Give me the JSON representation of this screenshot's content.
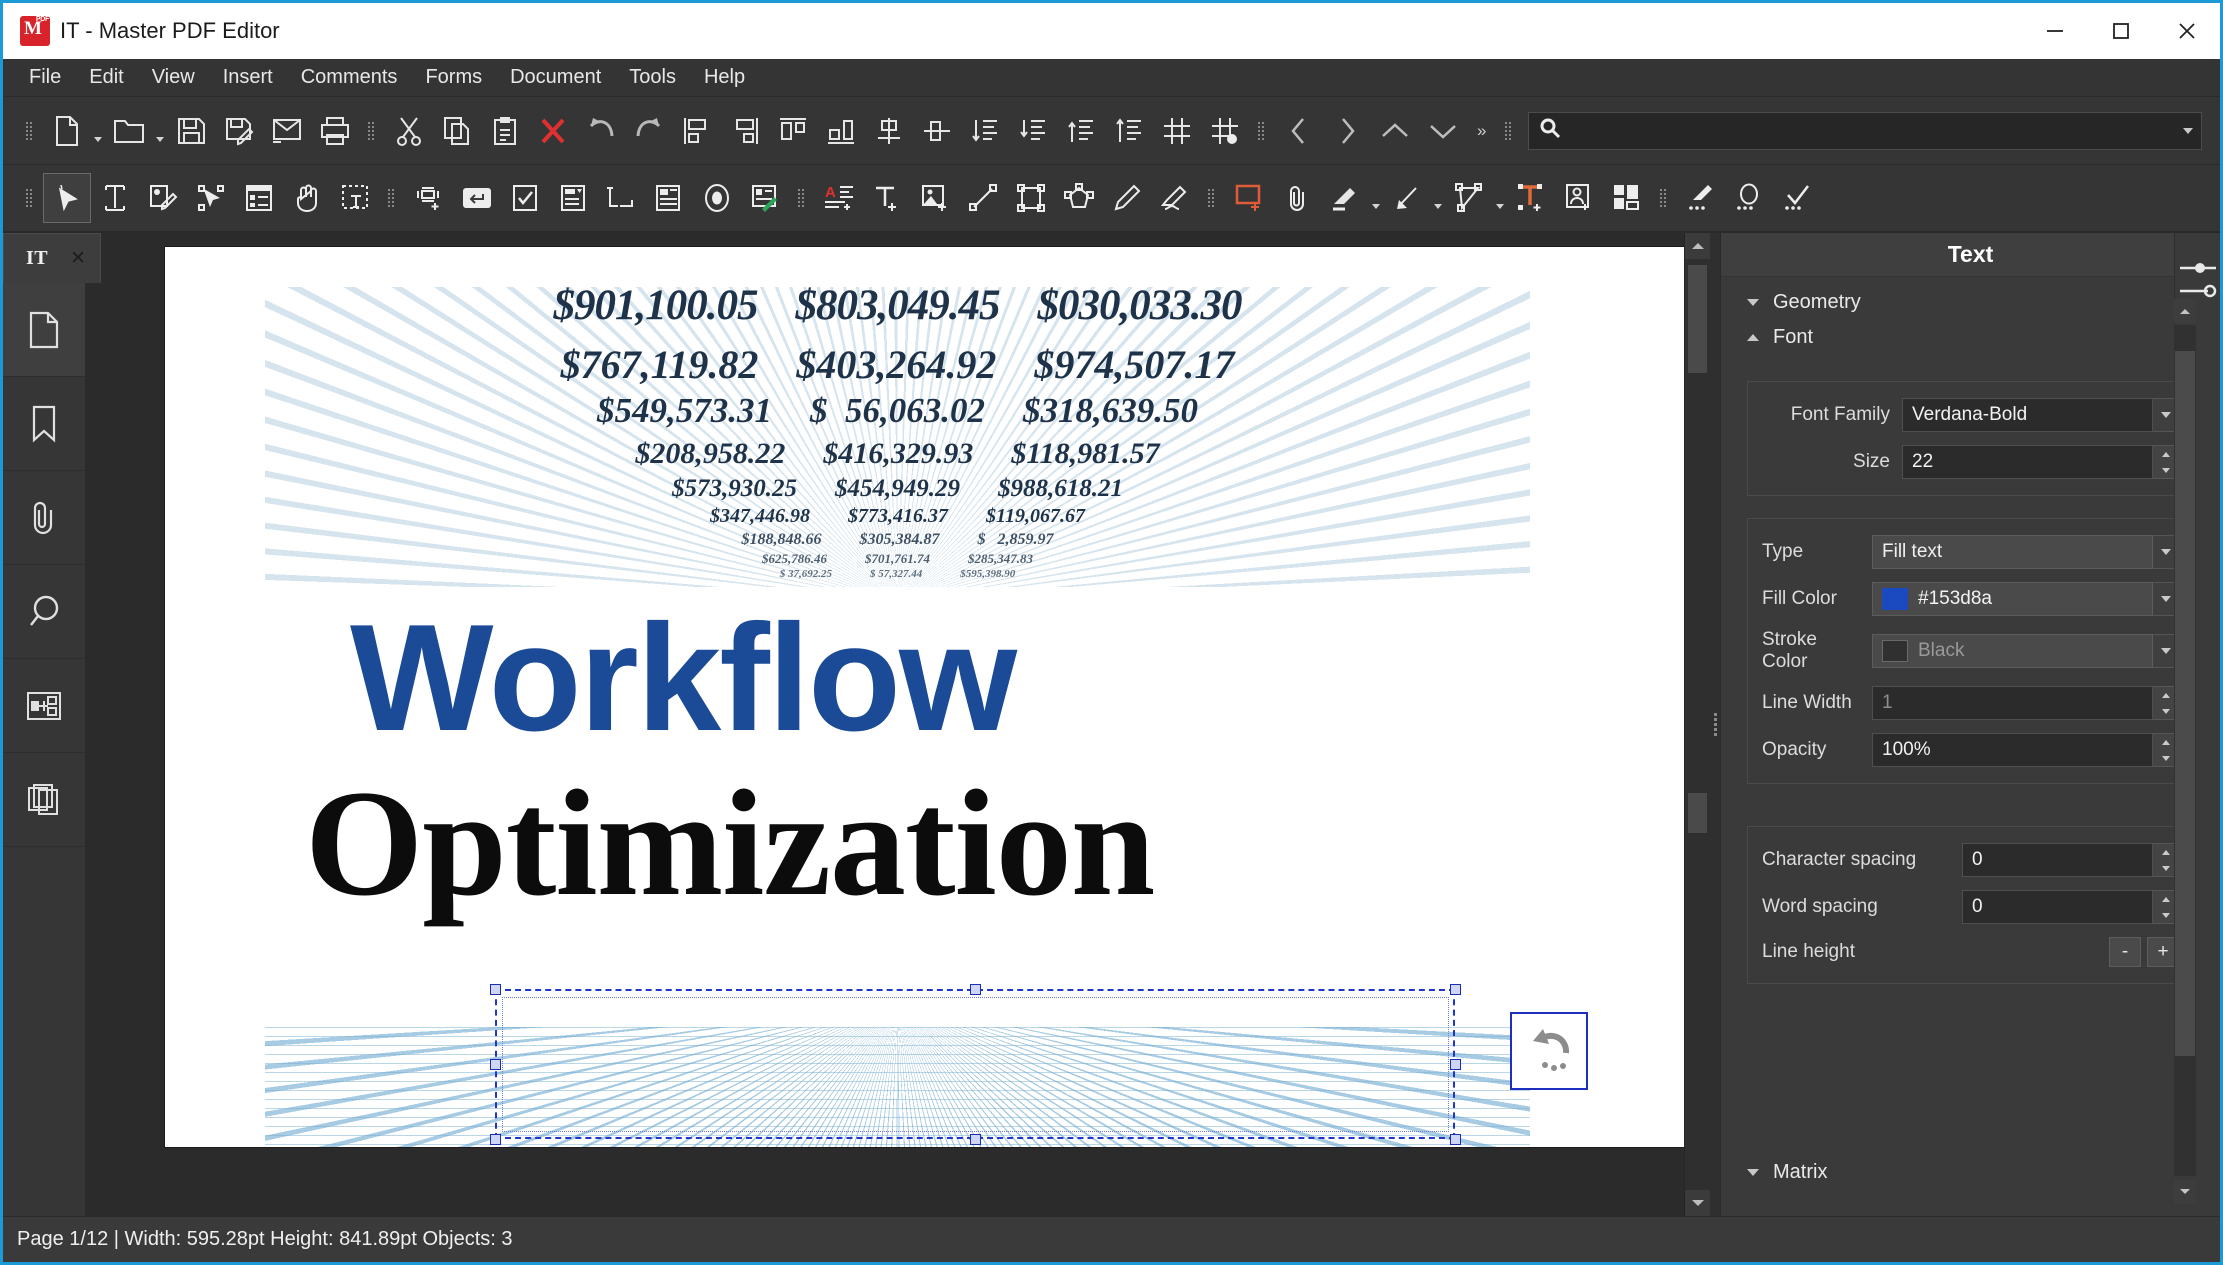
{
  "window": {
    "title": "IT - Master PDF Editor",
    "app_icon": "master-pdf-editor-icon",
    "pdf_badge": "PDF",
    "minimize": "—",
    "maximize": "□",
    "close": "✕"
  },
  "menu": [
    "File",
    "Edit",
    "View",
    "Insert",
    "Comments",
    "Forms",
    "Document",
    "Tools",
    "Help"
  ],
  "toolbar_main": [
    {
      "name": "new-document-icon",
      "has_caret": true
    },
    {
      "name": "open-document-icon",
      "has_caret": true
    },
    {
      "name": "save-icon",
      "has_caret": false
    },
    {
      "name": "save-as-icon",
      "has_caret": false
    },
    {
      "name": "email-icon",
      "has_caret": false
    },
    {
      "name": "print-icon",
      "has_caret": false
    },
    {
      "name": "cut-icon",
      "has_caret": false
    },
    {
      "name": "copy-icon",
      "has_caret": false
    },
    {
      "name": "paste-icon",
      "has_caret": false
    },
    {
      "name": "delete-icon",
      "has_caret": false
    },
    {
      "name": "undo-icon",
      "has_caret": false
    },
    {
      "name": "redo-icon",
      "has_caret": false
    },
    {
      "name": "align-left-icon",
      "has_caret": false
    },
    {
      "name": "align-right-icon",
      "has_caret": false
    },
    {
      "name": "align-top-icon",
      "has_caret": false
    },
    {
      "name": "align-bottom-icon",
      "has_caret": false
    },
    {
      "name": "align-center-vertical-icon",
      "has_caret": false
    },
    {
      "name": "align-center-horizontal-icon",
      "has_caret": false
    },
    {
      "name": "distribute-down-icon",
      "has_caret": false
    },
    {
      "name": "distribute-down-alt-icon",
      "has_caret": false
    },
    {
      "name": "distribute-up-icon",
      "has_caret": false
    },
    {
      "name": "distribute-up-alt-icon",
      "has_caret": false
    },
    {
      "name": "grid-icon",
      "has_caret": false
    },
    {
      "name": "snap-to-grid-icon",
      "has_caret": false
    },
    {
      "name": "previous-page-icon",
      "has_caret": false
    },
    {
      "name": "next-page-icon",
      "has_caret": false
    },
    {
      "name": "scroll-up-icon",
      "has_caret": false
    },
    {
      "name": "scroll-down-icon",
      "has_caret": false
    }
  ],
  "toolbar_more_label": "»",
  "search": {
    "icon": "search-icon",
    "value": "",
    "placeholder": ""
  },
  "toolbar_edit": [
    {
      "name": "select-tool-icon",
      "active": true
    },
    {
      "name": "edit-text-tool-icon",
      "active": false
    },
    {
      "name": "edit-image-tool-icon",
      "active": false
    },
    {
      "name": "edit-object-tool-icon",
      "active": false
    },
    {
      "name": "forms-tool-icon",
      "active": false
    },
    {
      "name": "hand-tool-icon",
      "active": false
    },
    {
      "name": "select-text-tool-icon",
      "active": false
    },
    {
      "name": "text-field-icon",
      "active": false
    },
    {
      "name": "button-field-icon",
      "active": false
    },
    {
      "name": "checkbox-field-icon",
      "active": false
    },
    {
      "name": "combobox-field-icon",
      "active": false
    },
    {
      "name": "listbox-field-icon",
      "active": false
    },
    {
      "name": "listbox-alt-field-icon",
      "active": false
    },
    {
      "name": "radio-button-field-icon",
      "active": false
    },
    {
      "name": "signature-field-icon",
      "active": false
    },
    {
      "name": "add-text-block-icon",
      "active": false
    },
    {
      "name": "add-text-icon",
      "active": false
    },
    {
      "name": "add-image-icon",
      "active": false
    },
    {
      "name": "add-line-icon",
      "active": false
    },
    {
      "name": "add-rectangle-icon",
      "active": false
    },
    {
      "name": "add-polygon-icon",
      "active": false
    },
    {
      "name": "pencil-icon",
      "active": false
    },
    {
      "name": "eraser-icon",
      "active": false
    },
    {
      "name": "note-annotation-icon",
      "active": false
    },
    {
      "name": "attach-file-icon",
      "active": false
    },
    {
      "name": "highlight-icon",
      "active": false,
      "has_caret": true
    },
    {
      "name": "draw-arrow-icon",
      "active": false,
      "has_caret": true
    },
    {
      "name": "draw-polyline-icon",
      "active": false,
      "has_caret": true
    },
    {
      "name": "text-box-icon",
      "active": false
    },
    {
      "name": "stamp-icon",
      "active": false
    },
    {
      "name": "page-layout-icon",
      "active": false
    },
    {
      "name": "redaction-icon",
      "active": false
    },
    {
      "name": "magnifier-icon",
      "active": false
    },
    {
      "name": "checkmark-icon",
      "active": false
    }
  ],
  "document_tab": {
    "label": "IT",
    "close": "✕"
  },
  "left_rail": [
    {
      "name": "pages-panel-icon",
      "active": true
    },
    {
      "name": "bookmarks-panel-icon",
      "active": false
    },
    {
      "name": "attachments-panel-icon",
      "active": false
    },
    {
      "name": "search-panel-icon",
      "active": false
    },
    {
      "name": "layers-panel-icon",
      "active": false
    },
    {
      "name": "page-thumbnails-panel-icon",
      "active": false
    }
  ],
  "document": {
    "headline_selected": "Workflow",
    "headline_second": "Optimization",
    "headline_selected_color": "#1b4a96",
    "headline_second_color": "#0c0c0c",
    "numbers_rows": [
      [
        "$901,100.05",
        "$803,049.45",
        "$030,033.30"
      ],
      [
        "$767,119.82",
        "$403,264.92",
        "$974,507.17"
      ],
      [
        "$549,573.31",
        "$  56,063.02",
        "$318,639.50"
      ],
      [
        "$208,958.22",
        "$416,329.93",
        "$118,981.57"
      ],
      [
        "$573,930.25",
        "$454,949.29",
        "$988,618.21"
      ],
      [
        "$347,446.98",
        "$773,416.37",
        "$119,067.67"
      ],
      [
        "$188,848.66",
        "$305,384.87",
        "$   2,859.97"
      ],
      [
        "$625,786.46",
        "$701,761.74",
        "$285,347.83"
      ],
      [
        "$ 37,692.25",
        "$ 57,327.44",
        "$595,398.90"
      ]
    ]
  },
  "right_panel": {
    "title": "Text",
    "toggle_icon": "sliders-icon",
    "sections": [
      {
        "label": "Geometry",
        "expanded": false
      },
      {
        "label": "Font",
        "expanded": true
      },
      {
        "label": "Matrix",
        "expanded": false
      }
    ],
    "font": {
      "font_family_label": "Font Family",
      "font_family_value": "Verdana-Bold",
      "size_label": "Size",
      "size_value": "22"
    },
    "appearance": {
      "type_label": "Type",
      "type_value": "Fill text",
      "fill_color_label": "Fill Color",
      "fill_color_value": "#153d8a",
      "fill_color_swatch": "#1b4ac0",
      "stroke_color_label": "Stroke Color",
      "stroke_color_value": "Black",
      "stroke_color_swatch": "#303030",
      "line_width_label": "Line Width",
      "line_width_value": "1",
      "opacity_label": "Opacity",
      "opacity_value": "100%"
    },
    "spacing": {
      "character_spacing_label": "Character spacing",
      "character_spacing_value": "0",
      "word_spacing_label": "Word spacing",
      "word_spacing_value": "0",
      "line_height_label": "Line height",
      "line_height_minus": "-",
      "line_height_plus": "+"
    }
  },
  "statusbar": {
    "text": "Page 1/12 | Width: 595.28pt Height: 841.89pt Objects: 3"
  }
}
